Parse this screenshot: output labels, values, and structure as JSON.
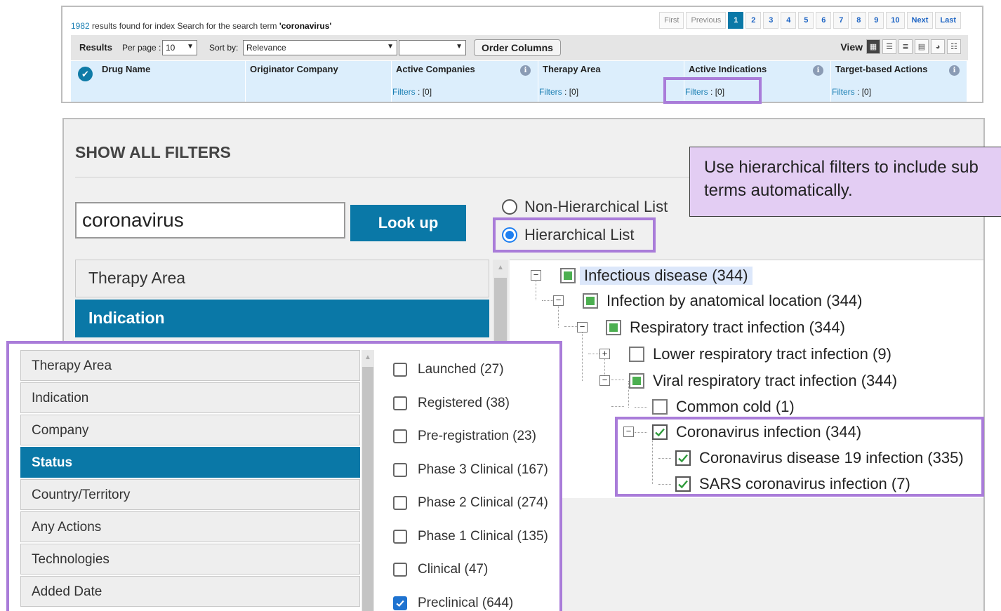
{
  "results": {
    "count": "1982",
    "text_pre": "results found for index Search for the search term",
    "term": "'coronavirus'",
    "pagination": [
      "First",
      "Previous",
      "1",
      "2",
      "3",
      "4",
      "5",
      "6",
      "7",
      "8",
      "9",
      "10",
      "Next",
      "Last"
    ],
    "current_page": "1",
    "toolbar": {
      "results_label": "Results",
      "per_page_label": "Per page :",
      "per_page_value": "10",
      "sort_label": "Sort by:",
      "sort_value": "Relevance",
      "sort_secondary_value": "",
      "order_columns_label": "Order Columns",
      "view_label": "View"
    },
    "columns": [
      {
        "name": "Drug Name",
        "has_info": false,
        "filter": ""
      },
      {
        "name": "Originator Company",
        "has_info": false,
        "filter": ""
      },
      {
        "name": "Active Companies",
        "has_info": true,
        "filter": "[0]"
      },
      {
        "name": "Therapy Area",
        "has_info": false,
        "filter": "[0]"
      },
      {
        "name": "Active Indications",
        "has_info": true,
        "filter": "[0]"
      },
      {
        "name": "Target-based Actions",
        "has_info": true,
        "filter": "[0]"
      }
    ],
    "filters_link_label": "Filters",
    "info_glyph": "i"
  },
  "filters": {
    "title": "SHOW ALL FILTERS",
    "search_value": "coronavirus",
    "lookup_label": "Look up",
    "radio_non_hier": "Non-Hierarchical List",
    "radio_hier": "Hierarchical List",
    "selected_radio": "hierarchical",
    "big_categories": [
      "Therapy Area",
      "Indication"
    ],
    "big_selected": "Indication",
    "tree": [
      {
        "label": "Infectious disease (344)",
        "state": "partial"
      },
      {
        "label": "Infection by anatomical location (344)",
        "state": "partial"
      },
      {
        "label": "Respiratory tract infection (344)",
        "state": "partial"
      },
      {
        "label": "Lower respiratory tract infection (9)",
        "state": "none"
      },
      {
        "label": "Viral respiratory tract infection (344)",
        "state": "partial"
      },
      {
        "label": "Common cold (1)",
        "state": "none"
      },
      {
        "label": "Coronavirus infection (344)",
        "state": "checked"
      },
      {
        "label": "Coronavirus disease 19 infection (335)",
        "state": "checked"
      },
      {
        "label": "SARS coronavirus infection (7)",
        "state": "checked"
      }
    ]
  },
  "callout": {
    "text": "Use hierarchical filters to include sub terms automatically."
  },
  "status_popup": {
    "categories": [
      "Therapy Area",
      "Indication",
      "Company",
      "Status",
      "Country/Territory",
      "Any Actions",
      "Technologies",
      "Added Date"
    ],
    "selected_category": "Status",
    "statuses": [
      {
        "label": "Launched (27)",
        "checked": false
      },
      {
        "label": "Registered (38)",
        "checked": false
      },
      {
        "label": "Pre-registration (23)",
        "checked": false
      },
      {
        "label": "Phase 3 Clinical (167)",
        "checked": false
      },
      {
        "label": "Phase 2 Clinical (274)",
        "checked": false
      },
      {
        "label": "Phase 1 Clinical (135)",
        "checked": false
      },
      {
        "label": "Clinical (47)",
        "checked": false
      },
      {
        "label": "Preclinical (644)",
        "checked": true
      }
    ]
  },
  "colors": {
    "accent": "#0a78a7",
    "highlight_border": "#a97cd9",
    "callout_bg": "#e3cdf3",
    "partial_fill": "#4caf50",
    "checkmark": "#2e9b3b",
    "link": "#1b7fb3"
  },
  "icons": {
    "check_all": "check-circle-icon",
    "info": "info-icon",
    "expand": "plus-box-icon",
    "collapse": "minus-box-icon"
  }
}
